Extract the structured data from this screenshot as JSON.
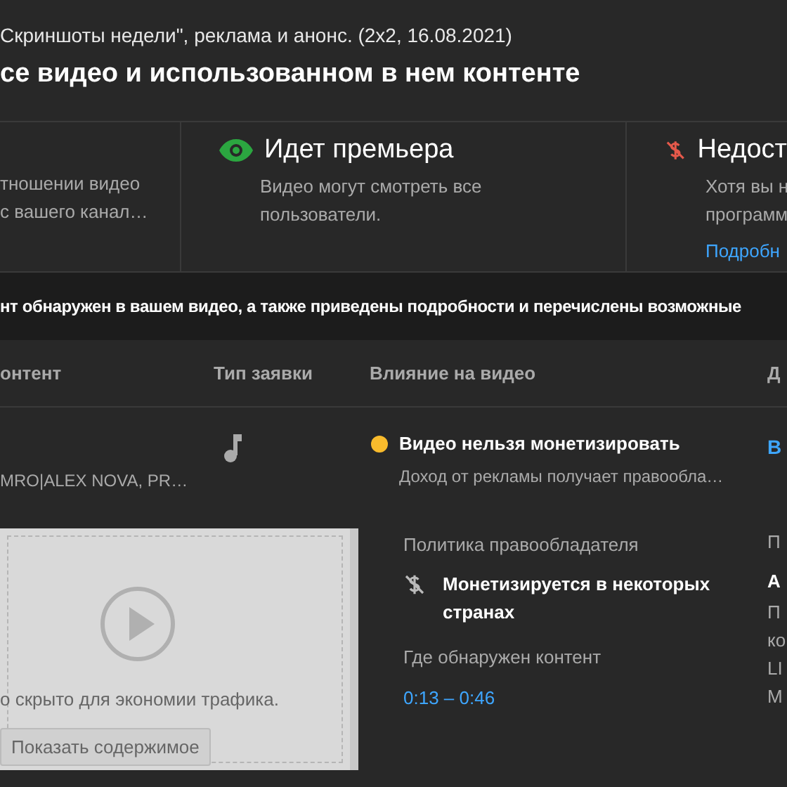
{
  "header": {
    "subtitle": "Скриншоты недели\", реклама и анонс. (2x2, 16.08.2021)",
    "title": "се видео и использованном в нем контенте"
  },
  "status_cards": [
    {
      "kind": "text",
      "lines": [
        "тношении видео",
        "с вашего канал…"
      ]
    },
    {
      "kind": "visible",
      "title": "Идет премьера",
      "lines": [
        "Видео могут смотреть все",
        "пользователи."
      ]
    },
    {
      "kind": "demonetized",
      "title": "Недост",
      "lines": [
        "Хотя вы н",
        "программ"
      ],
      "link": "Подробн"
    }
  ],
  "notice": "нт обнаружен в вашем видео, а также приведены подробности и перечислены возможные",
  "table": {
    "columns": [
      "онтент",
      "Тип заявки",
      "Влияние на видео",
      "Д"
    ],
    "rows": [
      {
        "content": "MRO|ALEX NOVA, PR…",
        "claim_type": {
          "kind": "music"
        },
        "impact": {
          "kind": "warning",
          "title": "Видео нельзя монетизировать",
          "description": "Доход от рекламы получает правообла…"
        },
        "action": "В",
        "thumbnail": {
          "message": "о скрыто для экономии трафика.",
          "button": "Показать содержимое"
        },
        "policy_label": "Политика правообладателя",
        "policy": {
          "kind": "partial",
          "text": "Монетизируется в некоторых странах"
        },
        "location_label": "Где обнаружен контент",
        "location": "0:13 – 0:46",
        "details": [
          {
            "kind": "label",
            "text": "П"
          },
          {
            "kind": "value",
            "text": "A"
          },
          {
            "kind": "line",
            "text": "П"
          },
          {
            "kind": "line",
            "text": "ко"
          },
          {
            "kind": "line",
            "text": "LI"
          },
          {
            "kind": "line",
            "text": "М"
          }
        ]
      }
    ]
  }
}
